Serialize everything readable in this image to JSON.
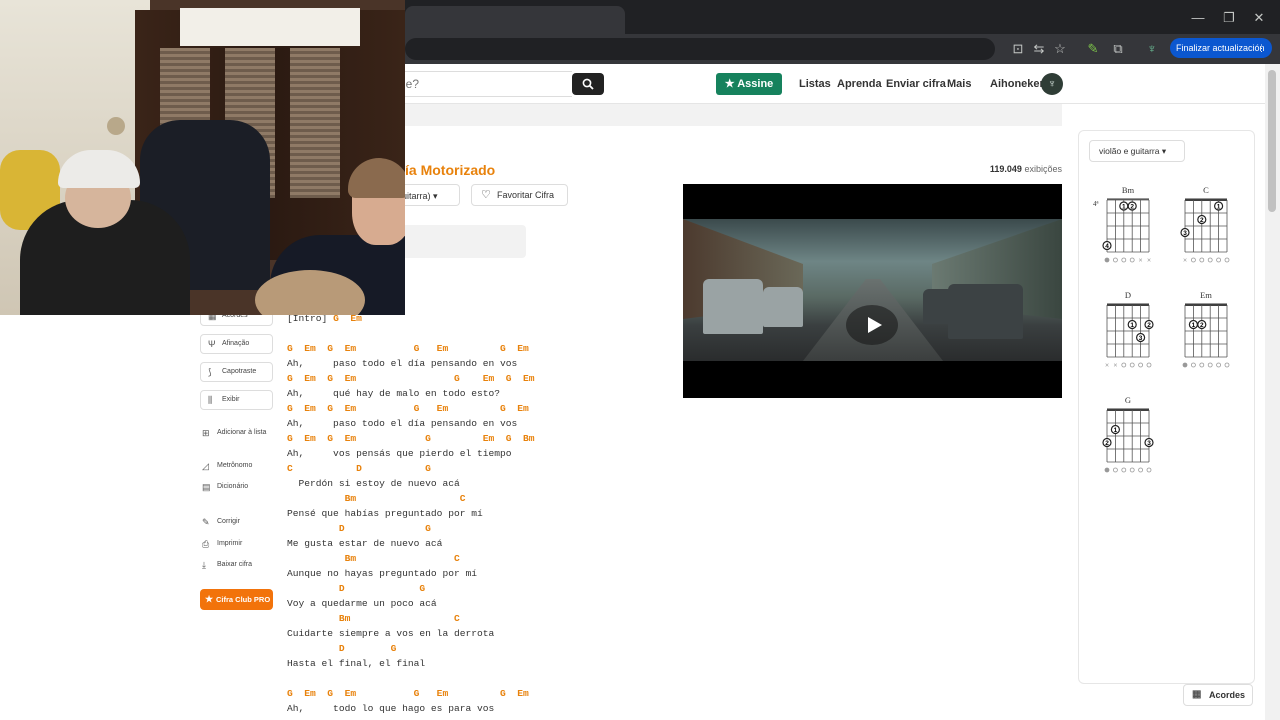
{
  "browser": {
    "update_button": "Finalizar actualización"
  },
  "header": {
    "search_placeholder": "je?",
    "assine": "Assine",
    "nav": [
      "Listas",
      "Aprenda",
      "Enviar cifra",
      "Mais"
    ],
    "username": "Aihoneker"
  },
  "song": {
    "artist_fragment": "ía Motorizado",
    "views_number": "119.049",
    "views_label": "exibições",
    "instrument_fragment": "uitarra)",
    "favorite": "Favoritar Cifra"
  },
  "sidebar": {
    "buttons": [
      "Acordes",
      "Afinação",
      "Capotraste",
      "Exibir"
    ],
    "add_to_list": "Adicionar à lista",
    "tools": [
      "Metrônomo",
      "Dicionário"
    ],
    "actions": [
      "Corrigir",
      "Imprimir",
      "Baixar cifra"
    ],
    "pro": "Cifra Club PRO"
  },
  "lyrics": [
    {
      "t": "tx",
      "v": "[Intro] ",
      "c": "G  Em"
    },
    {
      "t": "gap"
    },
    {
      "t": "ch",
      "v": "G  Em  G  Em          G   Em         G  Em"
    },
    {
      "t": "tx",
      "v": "Ah,     paso todo el día pensando en vos"
    },
    {
      "t": "ch",
      "v": "G  Em  G  Em                 G    Em  G  Em"
    },
    {
      "t": "tx",
      "v": "Ah,     qué hay de malo en todo esto?"
    },
    {
      "t": "ch",
      "v": "G  Em  G  Em          G   Em         G  Em"
    },
    {
      "t": "tx",
      "v": "Ah,     paso todo el día pensando en vos"
    },
    {
      "t": "ch",
      "v": "G  Em  G  Em            G         Em  G  Bm"
    },
    {
      "t": "tx",
      "v": "Ah,     vos pensás que pierdo el tiempo"
    },
    {
      "t": "ch",
      "v": "C           D           G"
    },
    {
      "t": "tx",
      "v": "  Perdón si estoy de nuevo acá"
    },
    {
      "t": "ch",
      "v": "          Bm                  C"
    },
    {
      "t": "tx",
      "v": "Pensé que habías preguntado por mí"
    },
    {
      "t": "ch",
      "v": "         D              G"
    },
    {
      "t": "tx",
      "v": "Me gusta estar de nuevo acá"
    },
    {
      "t": "ch",
      "v": "          Bm                 C"
    },
    {
      "t": "tx",
      "v": "Aunque no hayas preguntado por mí"
    },
    {
      "t": "ch",
      "v": "         D             G"
    },
    {
      "t": "tx",
      "v": "Voy a quedarme un poco acá"
    },
    {
      "t": "ch",
      "v": "         Bm                  C"
    },
    {
      "t": "tx",
      "v": "Cuidarte siempre a vos en la derrota"
    },
    {
      "t": "ch",
      "v": "         D        G"
    },
    {
      "t": "tx",
      "v": "Hasta el final, el final"
    },
    {
      "t": "gap"
    },
    {
      "t": "ch",
      "v": "G  Em  G  Em          G   Em         G  Em"
    },
    {
      "t": "tx",
      "v": "Ah,     todo lo que hago es para vos"
    }
  ],
  "chords": {
    "selector": "violão e guitarra",
    "diagrams": [
      {
        "name": "Bm",
        "fret_label": "4ª"
      },
      {
        "name": "C"
      },
      {
        "name": "D"
      },
      {
        "name": "Em"
      },
      {
        "name": "G"
      }
    ],
    "panel_button": "Acordes"
  },
  "colors": {
    "accent_orange": "#e8820c",
    "assine_green": "#16825d",
    "pro_orange": "#f2730b"
  }
}
